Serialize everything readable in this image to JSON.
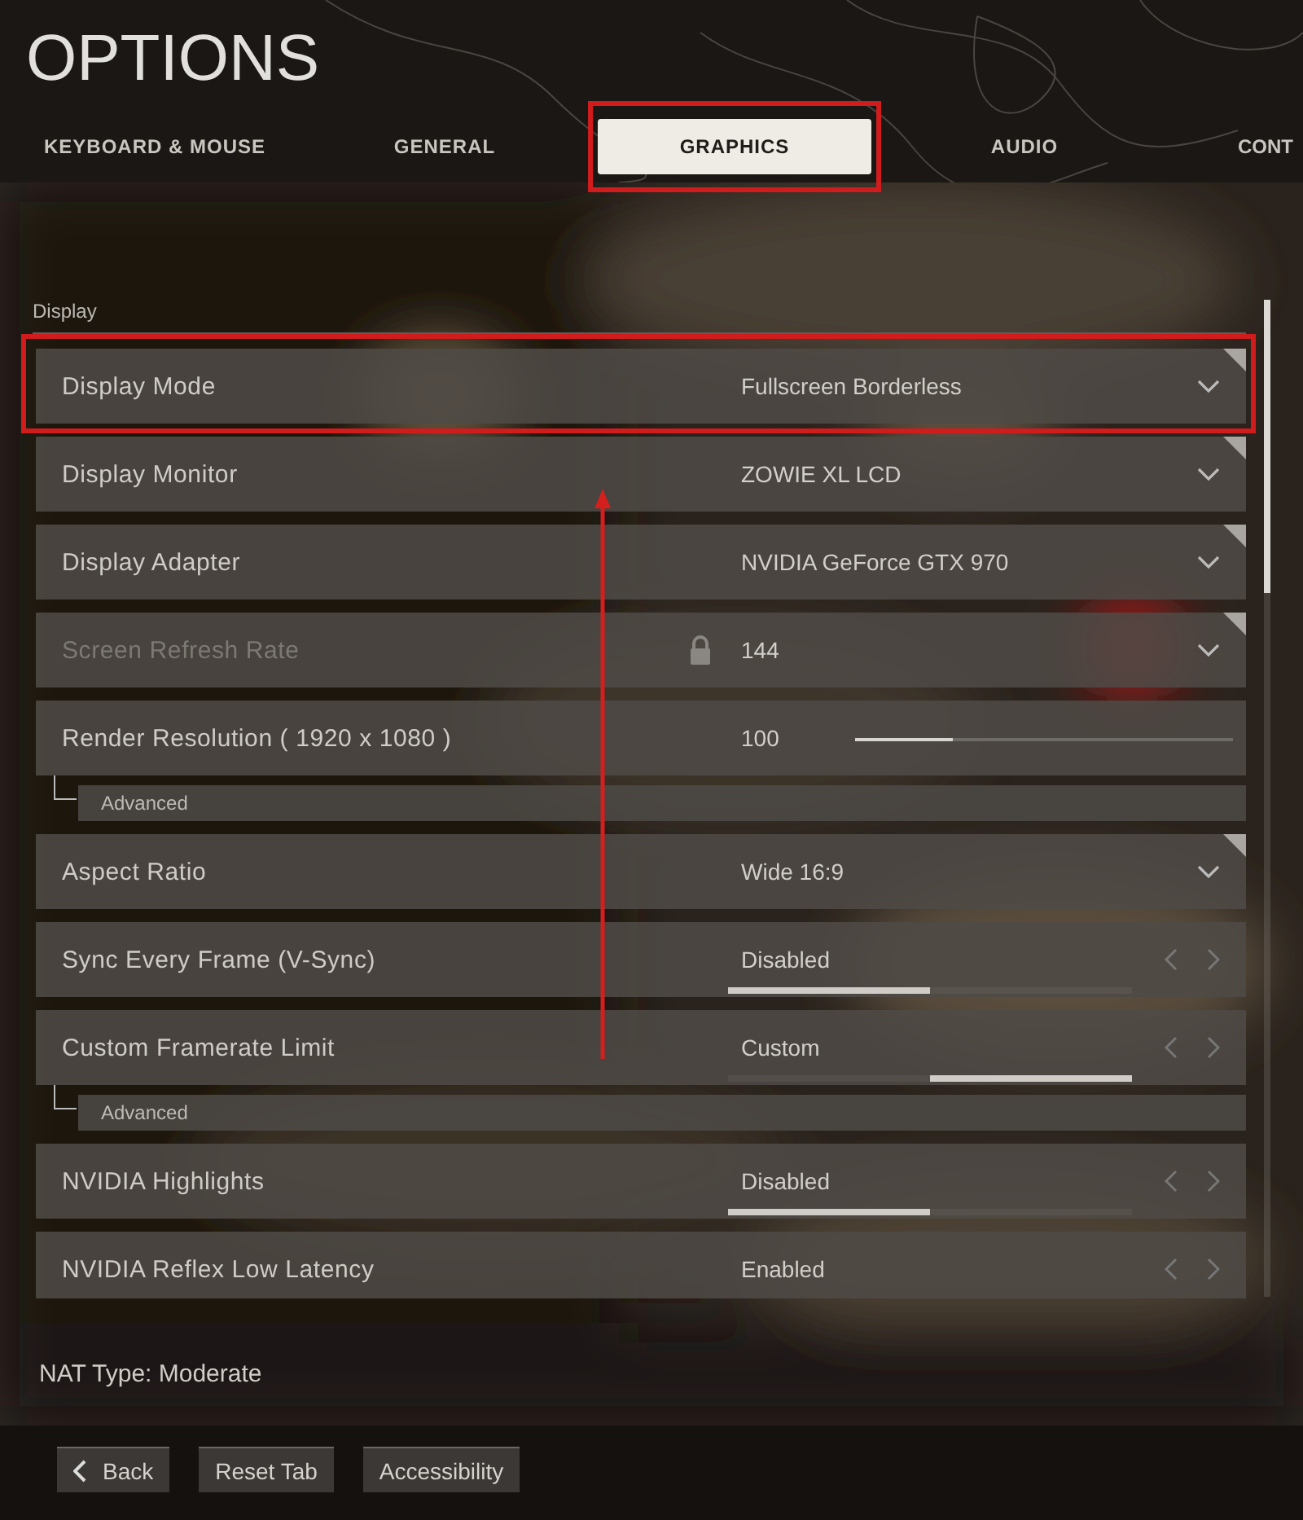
{
  "title": "OPTIONS",
  "tabs": [
    {
      "label": "KEYBOARD & MOUSE",
      "selected": false,
      "highlighted": false
    },
    {
      "label": "GENERAL",
      "selected": false,
      "highlighted": false
    },
    {
      "label": "GRAPHICS",
      "selected": true,
      "highlighted": true
    },
    {
      "label": "AUDIO",
      "selected": false,
      "highlighted": false
    },
    {
      "label": "CONT",
      "selected": false,
      "highlighted": false
    }
  ],
  "section": "Display",
  "settings": [
    {
      "kind": "dropdown",
      "label": "Display Mode",
      "value": "Fullscreen Borderless",
      "locked": false,
      "highlighted": true
    },
    {
      "kind": "dropdown",
      "label": "Display Monitor",
      "value": "ZOWIE XL LCD",
      "locked": false,
      "highlighted": false
    },
    {
      "kind": "dropdown",
      "label": "Display Adapter",
      "value": "NVIDIA GeForce GTX 970",
      "locked": false,
      "highlighted": false
    },
    {
      "kind": "dropdown",
      "label": "Screen Refresh Rate",
      "value": "144",
      "locked": true,
      "highlighted": false
    },
    {
      "kind": "slider",
      "label": "Render Resolution ( 1920 x 1080 )",
      "value": "100",
      "level": 0.26,
      "locked": false,
      "highlighted": false,
      "children": [
        {
          "label": "Advanced"
        }
      ]
    },
    {
      "kind": "dropdown",
      "label": "Aspect Ratio",
      "value": "Wide 16:9",
      "locked": false,
      "highlighted": false
    },
    {
      "kind": "toggle",
      "label": "Sync Every Frame (V-Sync)",
      "value": "Disabled",
      "indicator_right": false,
      "locked": false,
      "highlighted": false
    },
    {
      "kind": "toggle",
      "label": "Custom Framerate Limit",
      "value": "Custom",
      "indicator_right": true,
      "locked": false,
      "highlighted": false,
      "children": [
        {
          "label": "Advanced"
        }
      ]
    },
    {
      "kind": "toggle",
      "label": "NVIDIA Highlights",
      "value": "Disabled",
      "indicator_right": false,
      "locked": false,
      "highlighted": false
    },
    {
      "kind": "toggle",
      "label": "NVIDIA Reflex Low Latency",
      "value": "Enabled",
      "locked": false,
      "highlighted": false
    }
  ],
  "nat_type": "NAT Type: Moderate",
  "buttons": [
    {
      "label": "Back",
      "kind": "back"
    },
    {
      "label": "Reset Tab",
      "kind": "plain"
    },
    {
      "label": "Accessibility",
      "kind": "plain"
    }
  ]
}
